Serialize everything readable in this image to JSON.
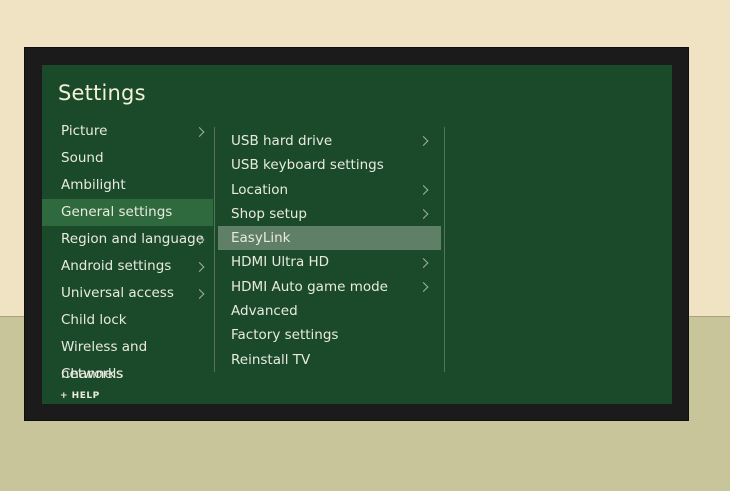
{
  "settings": {
    "title": "Settings",
    "help_label": "+ HELP",
    "left_menu": [
      {
        "label": "Picture",
        "chevron": true
      },
      {
        "label": "Sound",
        "chevron": false
      },
      {
        "label": "Ambilight",
        "chevron": false
      },
      {
        "label": "General settings",
        "chevron": false,
        "selected": true
      },
      {
        "label": "Region and language",
        "chevron": true
      },
      {
        "label": "Android settings",
        "chevron": true
      },
      {
        "label": "Universal access",
        "chevron": true
      },
      {
        "label": "Child lock",
        "chevron": false
      },
      {
        "label": "Wireless and networks",
        "chevron": false
      },
      {
        "label": "Channels",
        "chevron": false
      }
    ],
    "sub_menu": [
      {
        "label": "USB hard drive",
        "chevron": true
      },
      {
        "label": "USB keyboard settings",
        "chevron": false
      },
      {
        "label": "Location",
        "chevron": true
      },
      {
        "label": "Shop setup",
        "chevron": true
      },
      {
        "label": "EasyLink",
        "chevron": false,
        "highlighted": true
      },
      {
        "label": "HDMI Ultra HD",
        "chevron": true
      },
      {
        "label": "HDMI Auto game mode",
        "chevron": true
      },
      {
        "label": "Advanced",
        "chevron": false
      },
      {
        "label": "Factory settings",
        "chevron": false
      },
      {
        "label": "Reinstall TV",
        "chevron": false
      }
    ]
  },
  "colors": {
    "screen_bg": "#1b4a2b",
    "selected_left": "#2f6a3e",
    "highlight_mid": "#5f7f66",
    "wall": "#efe3c4",
    "floor": "#c9c59b"
  }
}
